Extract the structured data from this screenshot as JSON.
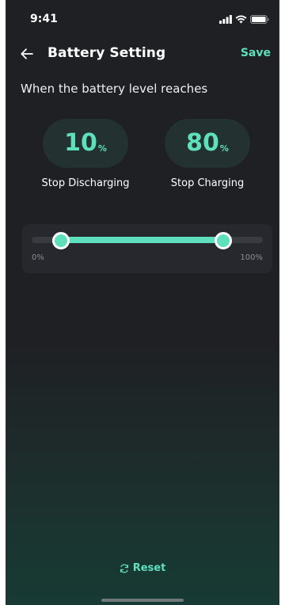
{
  "status_bar": {
    "time": "9:41",
    "icons": [
      "signal-icon",
      "wifi-icon",
      "battery-icon"
    ]
  },
  "header": {
    "back_icon": "arrow-left-icon",
    "title": "Battery Setting",
    "save_label": "Save"
  },
  "subtitle": "When the battery level reaches",
  "thresholds": {
    "discharge": {
      "value": "10",
      "unit": "%",
      "label": "Stop Discharging"
    },
    "charge": {
      "value": "80",
      "unit": "%",
      "label": "Stop Charging"
    }
  },
  "slider": {
    "min_label": "0%",
    "max_label": "100%",
    "low_value": 10,
    "high_value": 80
  },
  "reset": {
    "icon": "refresh-icon",
    "label": "Reset"
  },
  "colors": {
    "accent": "#5ee0bd",
    "background": "#1f2024",
    "card": "#27282d",
    "pill": "#233130"
  }
}
